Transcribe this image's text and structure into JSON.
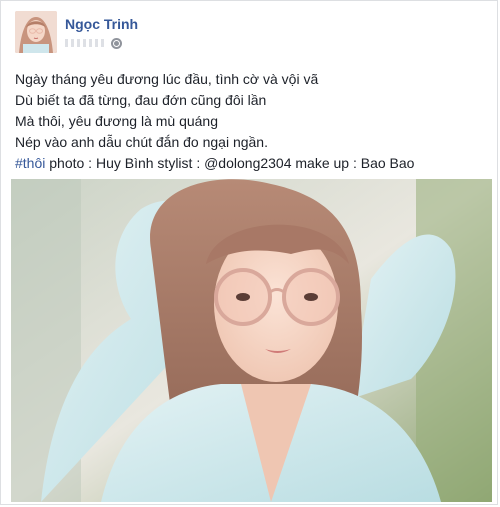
{
  "post": {
    "author": "Ngọc Trinh",
    "caption_lines": [
      "Ngày tháng yêu đương lúc đầu, tình cờ và vội vã",
      "Dù biết ta đã từng, đau đớn cũng đôi lần",
      "Mà thôi, yêu đương là mù quáng",
      "Nép vào anh dẫu chút đắn đo ngại ngần."
    ],
    "hashtag": "#thôi",
    "credits": " photo : Huy Bình stylist : @dolong2304 make up : Bao Bao"
  },
  "icons": {
    "privacy": "globe-icon"
  },
  "colors": {
    "link": "#365899",
    "text": "#1d2129",
    "border": "#dddfe2",
    "meta": "#90949c"
  }
}
